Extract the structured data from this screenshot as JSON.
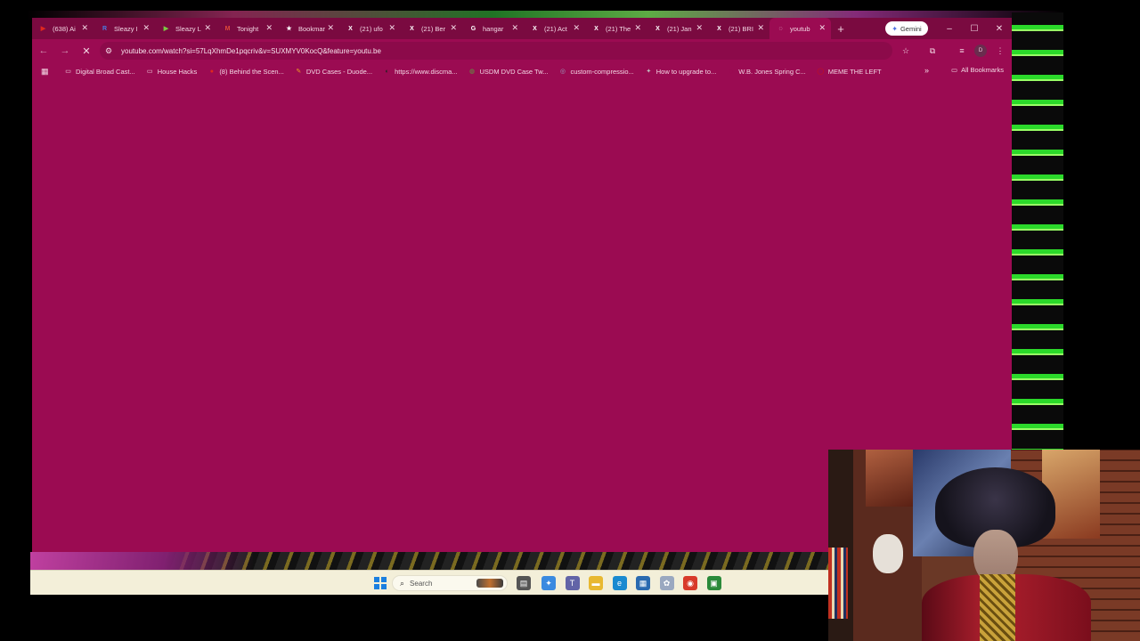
{
  "tabs": [
    {
      "title": "(638) Ai",
      "favicon": "youtube-icon",
      "color": "#e0281e",
      "active": false
    },
    {
      "title": "Sleazy I",
      "favicon": "r-icon",
      "color": "#4a7ae0",
      "active": false
    },
    {
      "title": "Sleazy L",
      "favicon": "rumble-icon",
      "color": "#7ac943",
      "active": false
    },
    {
      "title": "Tonight",
      "favicon": "gmail-icon",
      "color": "#e04a3a",
      "active": false
    },
    {
      "title": "Bookmar",
      "favicon": "star-icon",
      "color": "#ffffff",
      "active": false
    },
    {
      "title": "(21) ufo",
      "favicon": "x-icon",
      "color": "#ffffff",
      "active": false
    },
    {
      "title": "(21) Ber",
      "favicon": "x-icon",
      "color": "#ffffff",
      "active": false
    },
    {
      "title": "hangar",
      "favicon": "google-icon",
      "color": "#ffffff",
      "active": false
    },
    {
      "title": "(21) Act",
      "favicon": "x-icon",
      "color": "#ffffff",
      "active": false
    },
    {
      "title": "(21) The",
      "favicon": "x-icon",
      "color": "#ffffff",
      "active": false
    },
    {
      "title": "(21) Jan",
      "favicon": "x-icon",
      "color": "#ffffff",
      "active": false
    },
    {
      "title": "(21) BRI",
      "favicon": "x-icon",
      "color": "#ffffff",
      "active": false
    },
    {
      "title": "youtub",
      "favicon": "loading-icon",
      "color": "#f3d7e4",
      "active": true
    }
  ],
  "gemini_label": "Gemini",
  "address": "youtube.com/watch?si=57LqXhmDe1pqcriv&v=SUXMYV0KocQ&feature=youtu.be",
  "profile_initial": "D",
  "bookmarks": [
    {
      "label": "Digital Broad Cast...",
      "icon": "folder-icon",
      "color": "#f3d7e4"
    },
    {
      "label": "House Hacks",
      "icon": "folder-icon",
      "color": "#f3d7e4"
    },
    {
      "label": "(8) Behind the Scen...",
      "icon": "youtube-icon",
      "color": "#e0281e"
    },
    {
      "label": "DVD Cases - Duode...",
      "icon": "dvd-icon",
      "color": "#f0a020"
    },
    {
      "label": "https://www.discma...",
      "icon": "discma-icon",
      "color": "#222222"
    },
    {
      "label": "USDM DVD Case Tw...",
      "icon": "usdm-icon",
      "color": "#5aa040"
    },
    {
      "label": "custom-compressio...",
      "icon": "globe-icon",
      "color": "#9aa0c0"
    },
    {
      "label": "How to upgrade to...",
      "icon": "lightbulb-icon",
      "color": "#c0c0c0"
    },
    {
      "label": "W.B. Jones Spring C...",
      "icon": "wbjones-icon",
      "color": "#9b0b52"
    },
    {
      "label": "MEME THE LEFT",
      "icon": "meme-icon",
      "color": "#d01010"
    }
  ],
  "all_bookmarks_label": "All Bookmarks",
  "taskbar": {
    "search_placeholder": "Search",
    "apps": [
      {
        "name": "file-explorer-icon",
        "color": "#555555",
        "glyph": "▤"
      },
      {
        "name": "copilot-icon",
        "color": "#3a8ae0",
        "glyph": "✦"
      },
      {
        "name": "teams-icon",
        "color": "#6264a7",
        "glyph": "T"
      },
      {
        "name": "folder-icon",
        "color": "#e8b830",
        "glyph": "▬"
      },
      {
        "name": "edge-icon",
        "color": "#1a8ad0",
        "glyph": "e"
      },
      {
        "name": "store-icon",
        "color": "#2a6ab0",
        "glyph": "▦"
      },
      {
        "name": "app-icon",
        "color": "#9aa8c0",
        "glyph": "✿"
      },
      {
        "name": "chrome-icon",
        "color": "#d83a2a",
        "glyph": "◉"
      },
      {
        "name": "terminal-icon",
        "color": "#2a8a3a",
        "glyph": "▣"
      }
    ]
  }
}
